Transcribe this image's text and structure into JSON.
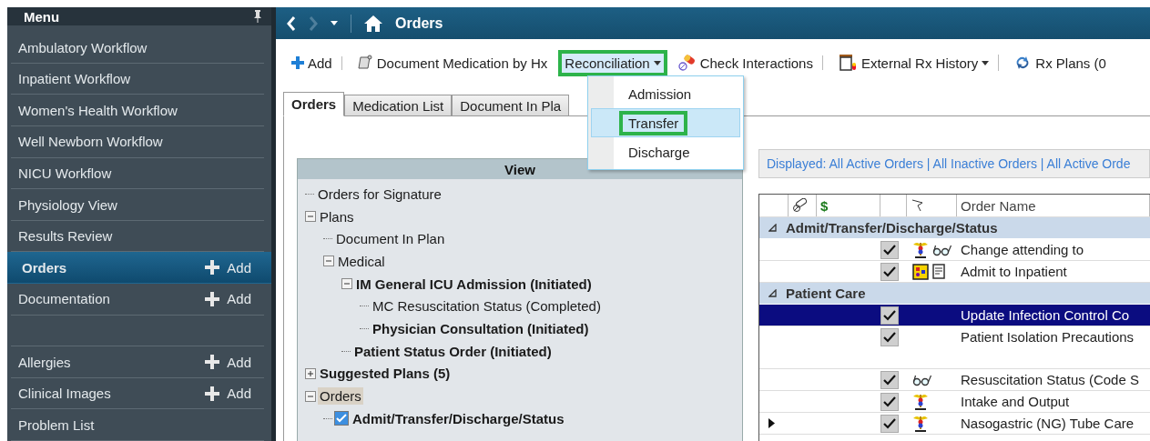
{
  "sidebar": {
    "title": "Menu",
    "items": [
      {
        "kind": "link",
        "label": "Ambulatory Workflow",
        "selected": false
      },
      {
        "kind": "link",
        "label": "Inpatient Workflow",
        "selected": false
      },
      {
        "kind": "link",
        "label": "Women's Health Workflow",
        "selected": false
      },
      {
        "kind": "link",
        "label": "Well Newborn Workflow",
        "selected": false
      },
      {
        "kind": "link",
        "label": "NICU Workflow",
        "selected": false
      },
      {
        "kind": "link",
        "label": "Physiology View",
        "selected": false
      },
      {
        "kind": "link",
        "label": "Results Review",
        "selected": false
      },
      {
        "kind": "link",
        "label": "Orders",
        "selected": true,
        "action": "Add"
      },
      {
        "kind": "link",
        "label": "Documentation",
        "selected": false,
        "action": "Add"
      },
      {
        "kind": "blank"
      },
      {
        "kind": "link",
        "label": "Allergies",
        "selected": false,
        "action": "Add"
      },
      {
        "kind": "link",
        "label": "Clinical Images",
        "selected": false,
        "action": "Add"
      },
      {
        "kind": "link",
        "label": "Problem List",
        "selected": false
      }
    ]
  },
  "header": {
    "title": "Orders"
  },
  "toolbar": [
    {
      "kind": "add",
      "label": "Add",
      "divider": true
    },
    {
      "kind": "document",
      "label": "Document Medication by Hx",
      "divider": false
    },
    {
      "kind": "menu",
      "label": "Reconciliation",
      "dropdown": true,
      "highlighted": true,
      "divider": false
    },
    {
      "kind": "check",
      "label": "Check Interactions",
      "divider": true
    },
    {
      "kind": "history",
      "label": "External Rx History",
      "dropdown": true,
      "divider": true
    },
    {
      "kind": "plans",
      "label": "Rx Plans (0",
      "divider": false
    }
  ],
  "menu": {
    "items": [
      {
        "label": "Admission",
        "selected": false,
        "highlighted": false
      },
      {
        "label": "Transfer",
        "selected": true,
        "highlighted": true
      },
      {
        "label": "Discharge",
        "selected": false,
        "highlighted": false
      }
    ]
  },
  "tabs": [
    {
      "label": "Orders",
      "selected": true
    },
    {
      "label": "Medication List",
      "selected": false
    },
    {
      "label": "Document In Pla",
      "selected": false
    }
  ],
  "tree": {
    "title": "View",
    "items": [
      {
        "label": "Orders for Signature",
        "bold": false,
        "selected": false
      },
      {
        "label": "Plans",
        "bold": false,
        "selected": false,
        "expanded": true,
        "children": [
          {
            "label": "Document In Plan",
            "bold": false,
            "selected": false
          },
          {
            "label": "Medical",
            "bold": false,
            "selected": false,
            "expanded": true,
            "children": [
              {
                "label": "IM General ICU Admission (Initiated)",
                "bold": true,
                "selected": false,
                "expanded": true,
                "children": [
                  {
                    "label": "MC Resuscitation Status (Completed)",
                    "bold": false,
                    "selected": false
                  },
                  {
                    "label": "Physician Consultation (Initiated)",
                    "bold": true,
                    "selected": false
                  }
                ]
              },
              {
                "label": "Patient Status Order (Initiated)",
                "bold": true,
                "selected": false
              }
            ]
          }
        ]
      },
      {
        "label": "Suggested Plans (5)",
        "bold": true,
        "selected": false,
        "expanded": false
      },
      {
        "label": "Orders",
        "bold": false,
        "selected": true,
        "expanded": true,
        "children": [
          {
            "label": "Admit/Transfer/Discharge/Status",
            "bold": true,
            "selected": false,
            "checked": true
          }
        ]
      }
    ]
  },
  "filter": "Displayed: All Active Orders | All Inactive Orders | All Active Orde",
  "grid": {
    "headers": [
      "$",
      "Order Name"
    ],
    "rows": [
      {
        "kind": "group",
        "label": "Admit/Transfer/Discharge/Status",
        "expanded": true
      },
      {
        "kind": "order",
        "label": "Change attending to",
        "checked": true,
        "selected": false,
        "current": false,
        "tall": false,
        "icons": [
          {
            "kind": "caduceus"
          },
          {
            "kind": "glasses"
          }
        ]
      },
      {
        "kind": "order",
        "label": "Admit to Inpatient",
        "checked": true,
        "selected": false,
        "current": false,
        "tall": false,
        "icons": [
          {
            "kind": "form"
          },
          {
            "kind": "note"
          }
        ]
      },
      {
        "kind": "group",
        "label": "Patient Care",
        "expanded": true
      },
      {
        "kind": "order",
        "label": "Update Infection Control Co",
        "checked": true,
        "selected": true,
        "current": false,
        "tall": false,
        "icons": []
      },
      {
        "kind": "order",
        "label": "Patient Isolation Precautions",
        "checked": true,
        "selected": false,
        "current": false,
        "tall": true,
        "icons": []
      },
      {
        "kind": "order",
        "label": "Resuscitation Status (Code S",
        "checked": true,
        "selected": false,
        "current": false,
        "tall": false,
        "icons": [
          {
            "kind": "glasses"
          }
        ]
      },
      {
        "kind": "order",
        "label": "Intake and Output",
        "checked": true,
        "selected": false,
        "current": false,
        "tall": false,
        "icons": [
          {
            "kind": "caduceus"
          }
        ]
      },
      {
        "kind": "order",
        "label": "Nasogastric (NG) Tube Care",
        "checked": true,
        "selected": false,
        "current": true,
        "tall": false,
        "icons": [
          {
            "kind": "caduceus"
          }
        ]
      }
    ]
  }
}
